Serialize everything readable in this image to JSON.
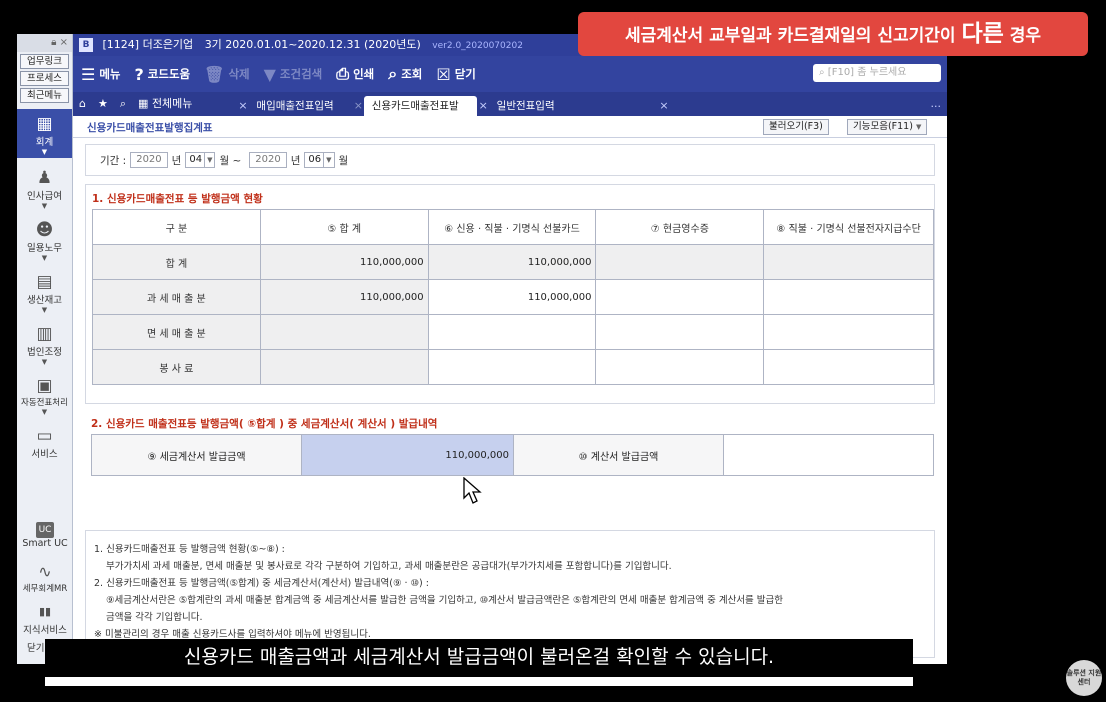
{
  "banner": {
    "prefix": "세금계산서 교부일과 카드결재일의 신고기간이",
    "emph": "다른",
    "suffix": "경우"
  },
  "subtitle": "신용카드 매출금액과 세금계산서 발급금액이 불러온걸 확인할 수 있습니다.",
  "seal_text": "솔루션 지원센터",
  "titlebar": {
    "company": "[1124] 더조은기업",
    "period": "3기 2020.01.01~2020.12.31 (2020년도)",
    "version": "ver2.0_2020070202",
    "close_glyph": "×"
  },
  "sidebar": {
    "quick_links": [
      "업무링크",
      "프로세스",
      "최근메뉴"
    ],
    "items": [
      {
        "label": "회계",
        "icon": "calculator-icon",
        "glyph": "▦",
        "active": true
      },
      {
        "label": "인사급여",
        "icon": "people-icon",
        "glyph": "♟"
      },
      {
        "label": "일용노무",
        "icon": "worker-icon",
        "glyph": "☻"
      },
      {
        "label": "생산재고",
        "icon": "grid-icon",
        "glyph": "▤"
      },
      {
        "label": "법인조정",
        "icon": "building-icon",
        "glyph": "▥"
      },
      {
        "label": "자동전표처리",
        "icon": "document-icon",
        "glyph": "▣"
      },
      {
        "label": "서비스",
        "icon": "monitor-icon",
        "glyph": "▭"
      }
    ],
    "bottom": [
      {
        "label": "Smart UC",
        "icon": "uc-icon",
        "glyph": "UC"
      },
      {
        "label": "세무회계MR",
        "icon": "chart-pulse-icon",
        "glyph": "∿"
      },
      {
        "label": "지식서비스",
        "icon": "book-icon",
        "glyph": "▮▮"
      },
      {
        "label": "닫기",
        "icon": "close-icon",
        "glyph": ""
      }
    ]
  },
  "toolbar": {
    "menu": "메뉴",
    "help": "코드도움",
    "delete": "삭제",
    "filter": "조건검색",
    "print": "인쇄",
    "inquiry": "조회",
    "close": "닫기",
    "search_placeholder": "[F10] 좀 누르세요"
  },
  "tabs": {
    "all_menu": "전체메뉴",
    "items": [
      "매입매출전표입력",
      "신용카드매출전표발",
      "일반전표입력"
    ],
    "active_index": 1,
    "more": "..."
  },
  "page": {
    "title": "신용카드매출전표발행집계표",
    "load_button": "불러오기(F3)",
    "func_button": "기능모음(F11)"
  },
  "period": {
    "label": "기간 :",
    "from_year": "2020",
    "from_month": "04",
    "to_year": "2020",
    "to_month": "06",
    "year_unit": "년",
    "month_unit": "월",
    "tilde": "월 ~"
  },
  "section1": {
    "title": "1. 신용카드매출전표 등 발행금액 현황",
    "headers": [
      "구          분",
      "⑤ 합          계",
      "⑥ 신용 · 직불 · 기명식 선불카드",
      "⑦ 현금영수증",
      "⑧ 직불 · 기명식 선불전자지급수단"
    ],
    "rows": [
      {
        "label": "합          계",
        "total": "110,000,000",
        "card": "110,000,000",
        "cash": "",
        "prepaid": ""
      },
      {
        "label": "과 세 매 출 분",
        "total": "110,000,000",
        "card": "110,000,000",
        "cash": "",
        "prepaid": ""
      },
      {
        "label": "면 세 매 출 분",
        "total": "",
        "card": "",
        "cash": "",
        "prepaid": ""
      },
      {
        "label": "봉     사     료",
        "total": "",
        "card": "",
        "cash": "",
        "prepaid": ""
      }
    ]
  },
  "section2": {
    "title": "2. 신용카드 매출전표등 발행금액( ⑤합계 ) 중 세금계산서( 계산서 ) 발급내역",
    "tax_invoice_label": "⑨ 세금계산서 발급금액",
    "tax_invoice_value": "110,000,000",
    "invoice_label": "⑩ 계산서 발급금액",
    "invoice_value": ""
  },
  "notes": [
    "1. 신용카드매출전표 등 발행금액 현황(⑤~⑧) :",
    "부가가치세 과세 매출분, 면세 매출분 및 봉사료로 각각 구분하여 기입하고, 과세 매출분란은 공급대가(부가가치세를 포함합니다)를 기입합니다.",
    "2. 신용카드매출전표 등 발행금액(⑤합계) 중 세금계산서(계산서) 발급내역(⑨ · ⑩) :",
    "⑨세금계산서란은 ⑤합계란의 과세 매출분 합계금액 중 세금계산서를 발급한 금액을 기입하고, ⑩계산서 발급금액란은 ⑤합계란의 면세 매출분 합계금액 중 계산서를 발급한",
    "금액을 각각 기입합니다.",
    "※ 미불관리의 경우 매출 신용카드사를 입력하셔야 메뉴에 반영됩니다."
  ]
}
